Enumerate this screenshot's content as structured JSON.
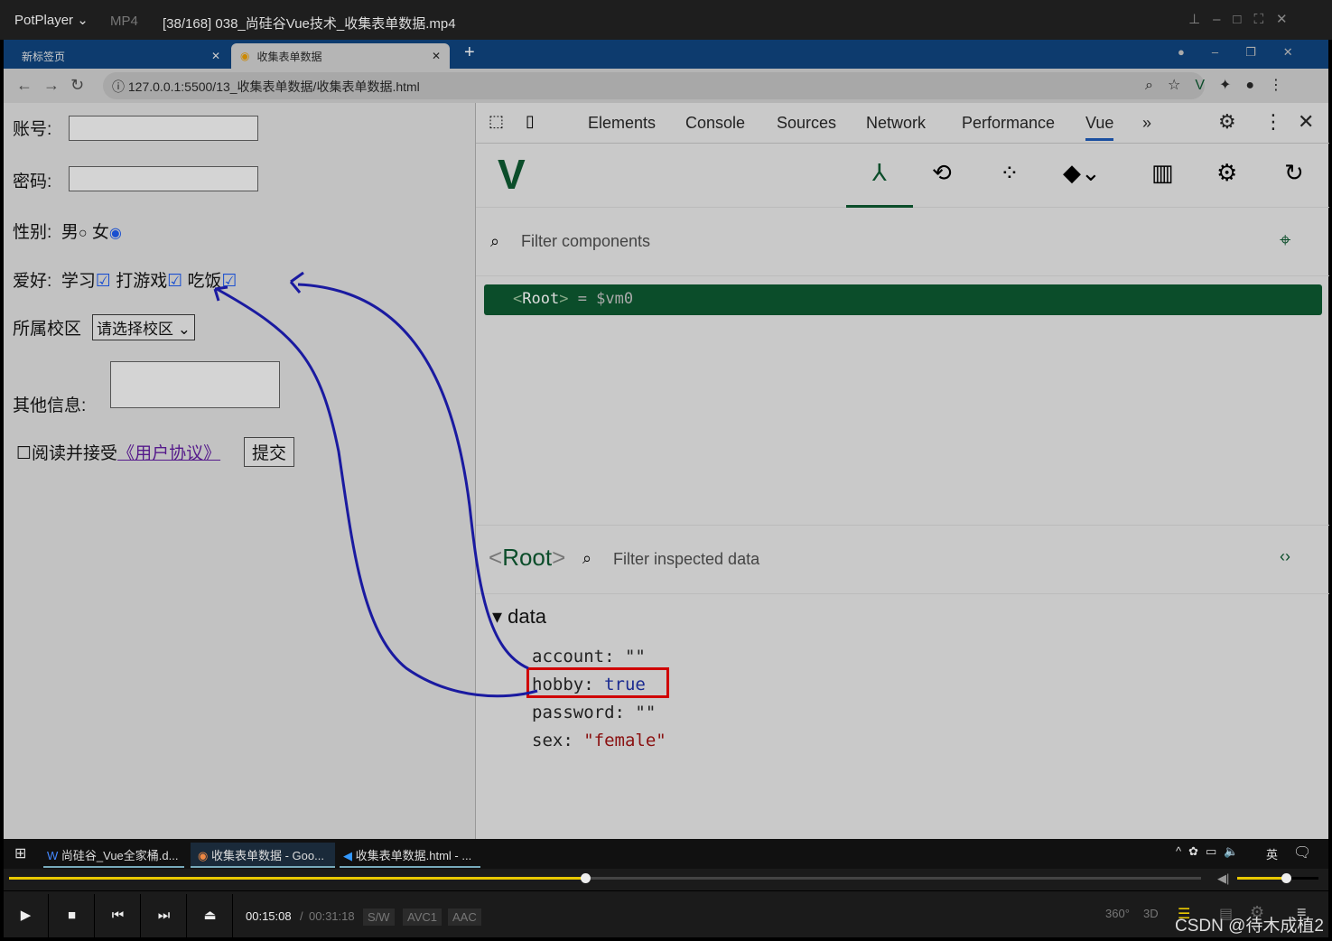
{
  "player": {
    "app": "PotPlayer",
    "format": "MP4",
    "title": "[38/168] 038_尚硅谷Vue技术_收集表单数据.mp4",
    "current_time": "00:15:08",
    "total_time": "00:31:18",
    "progress": 0.483,
    "volume": 0.6,
    "badges": [
      "S/W",
      "AVC1",
      "AAC"
    ],
    "right_icons": [
      "360°",
      "3D"
    ],
    "watermark": "CSDN @待木成植2"
  },
  "browser": {
    "tabs": [
      {
        "label": "新标签页"
      },
      {
        "label": "收集表单数据"
      }
    ],
    "url": "127.0.0.1:5500/13_收集表单数据/收集表单数据.html"
  },
  "form": {
    "account_label": "账号:",
    "password_label": "密码:",
    "sex_label": "性别:",
    "male": "男",
    "female": "女",
    "hobby_label": "爱好:",
    "hobbies": [
      "学习",
      "打游戏",
      "吃饭"
    ],
    "campus_label": "所属校区",
    "campus_select": "请选择校区",
    "other_label": "其他信息:",
    "agree_text": "阅读并接受",
    "agreement_link": "《用户协议》",
    "submit": "提交"
  },
  "devtools": {
    "tabs": [
      "Elements",
      "Console",
      "Sources",
      "Network",
      "Performance",
      "Vue"
    ],
    "active_tab": "Vue",
    "filter_placeholder": "Filter components",
    "root_component": "Root",
    "root_var": "= $vm0",
    "inspect_root": "Root",
    "inspect_filter": "Filter inspected data",
    "section": "data",
    "fields": [
      {
        "key": "account",
        "value": "\"\""
      },
      {
        "key": "hobby",
        "value": "true"
      },
      {
        "key": "password",
        "value": "\"\""
      },
      {
        "key": "sex",
        "value": "\"female\""
      }
    ]
  },
  "taskbar": {
    "items": [
      "尚硅谷_Vue全家桶.d...",
      "收集表单数据 - Goo...",
      "收集表单数据.html - ..."
    ],
    "ime": "英"
  },
  "colors": {
    "vue_green": "#0b4d2a",
    "highlight_red": "#d00000",
    "annotation_blue": "#1a1aa0",
    "progress_yellow": "#e8c800"
  }
}
